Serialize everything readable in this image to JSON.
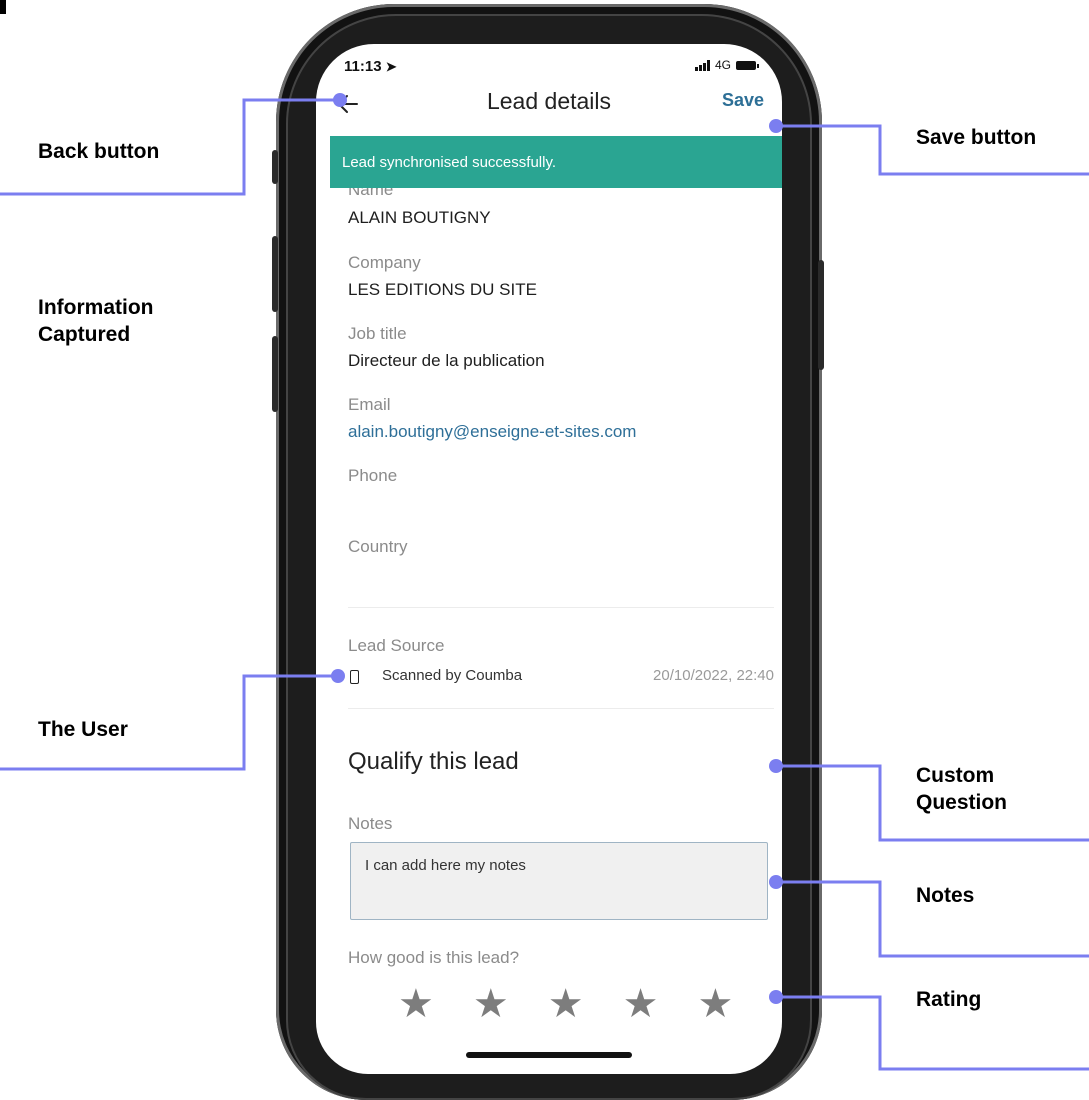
{
  "annotations": {
    "back": "Back button",
    "save": "Save button",
    "info_line1": "Information",
    "info_line2": "Captured",
    "user": "The User",
    "custom_line1": "Custom",
    "custom_line2": "Question",
    "notes": "Notes",
    "rating": "Rating"
  },
  "status_bar": {
    "time": "11:13",
    "network": "4G"
  },
  "header": {
    "title": "Lead details",
    "save_label": "Save",
    "back_icon": "arrow-left-icon"
  },
  "banner": {
    "message": "Lead synchronised successfully."
  },
  "fields": {
    "name_label": "Name",
    "name_value": "ALAIN BOUTIGNY",
    "company_label": "Company",
    "company_value": "LES EDITIONS DU SITE",
    "job_label": "Job title",
    "job_value": "Directeur de la publication",
    "email_label": "Email",
    "email_value": "alain.boutigny@enseigne-et-sites.com",
    "phone_label": "Phone",
    "country_label": "Country"
  },
  "lead_source": {
    "label": "Lead Source",
    "scanned_by": "Scanned by Coumba",
    "date": "20/10/2022, 22:40"
  },
  "qualify": {
    "title": "Qualify this lead",
    "notes_label": "Notes",
    "notes_value": "I can add here my notes",
    "rating_question": "How good is this lead?",
    "rating_max": 5,
    "rating_value": 0
  },
  "colors": {
    "accent": "#7b7ef0",
    "banner": "#2aa592",
    "link": "#2e6f98",
    "star": "#7d7d7d"
  }
}
